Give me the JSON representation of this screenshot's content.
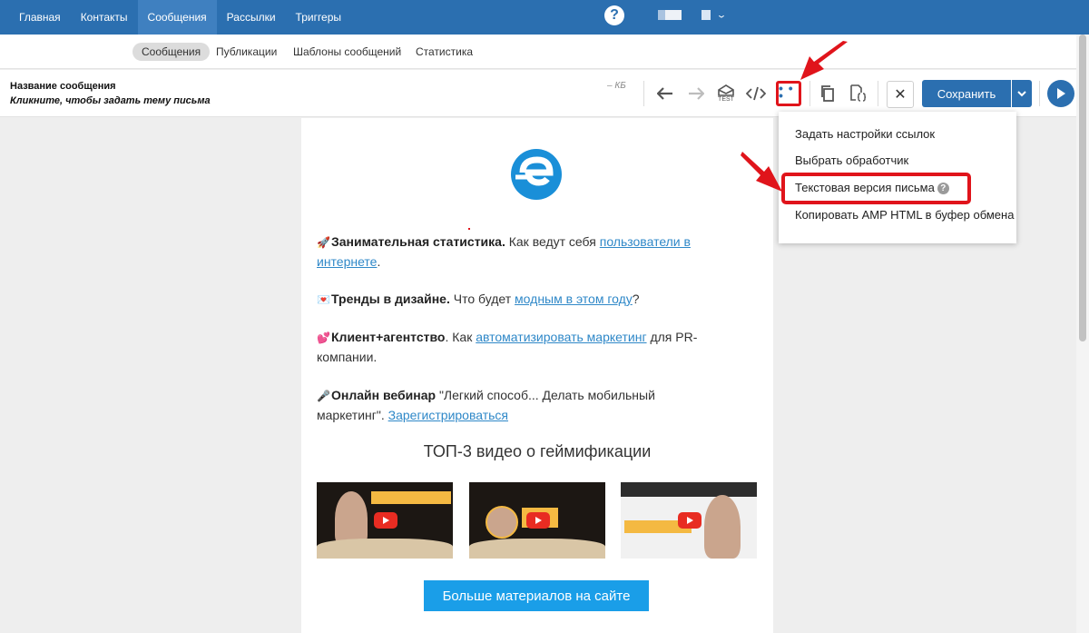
{
  "topnav": {
    "items": [
      {
        "label": "Главная"
      },
      {
        "label": "Контакты"
      },
      {
        "label": "Сообщения"
      },
      {
        "label": "Рассылки"
      },
      {
        "label": "Триггеры"
      }
    ],
    "active": "Сообщения",
    "help_label": "?"
  },
  "subnav": {
    "items": [
      {
        "label": "Сообщения"
      },
      {
        "label": "Публикации"
      },
      {
        "label": "Шаблоны сообщений"
      },
      {
        "label": "Статистика"
      }
    ],
    "active": "Сообщения"
  },
  "toolbar": {
    "message_name": "Название сообщения",
    "subject_hint": "Кликните, чтобы задать тему письма",
    "size": "– КБ",
    "test_label": "TEST",
    "save_label": "Сохранить",
    "close_label": "✕"
  },
  "dropdown": {
    "items": [
      {
        "label": "Задать настройки ссылок"
      },
      {
        "label": "Выбрать обработчик"
      },
      {
        "label": "Текстовая версия письма"
      },
      {
        "label": "Копировать AMP HTML в буфер обмена"
      }
    ],
    "help_mark": "?"
  },
  "email": {
    "p1": {
      "bold": "Занимательная статистика.",
      "text": " Как ведут себя ",
      "link": "пользователи в интернете",
      "end": "."
    },
    "p2": {
      "bold": "Тренды в дизайне.",
      "text": " Что будет ",
      "link": "модным в этом году",
      "end": "?"
    },
    "p3": {
      "bold": "Клиент+агентство",
      "text": ". Как ",
      "link": "автоматизировать маркетинг",
      "end": " для PR-компании."
    },
    "p4": {
      "bold": "Онлайн вебинар",
      "text": " \"Легкий способ... Делать мобильный маркетинг\". ",
      "link": "Зарегистрироваться"
    },
    "video_title": "ТОП-3 видео о геймификации",
    "more_button": "Больше материалов на сайте"
  },
  "colors": {
    "brand_blue": "#2b6fb0",
    "link": "#2f88c8",
    "highlight_red": "#e0141b",
    "cta": "#1a9ee8"
  }
}
